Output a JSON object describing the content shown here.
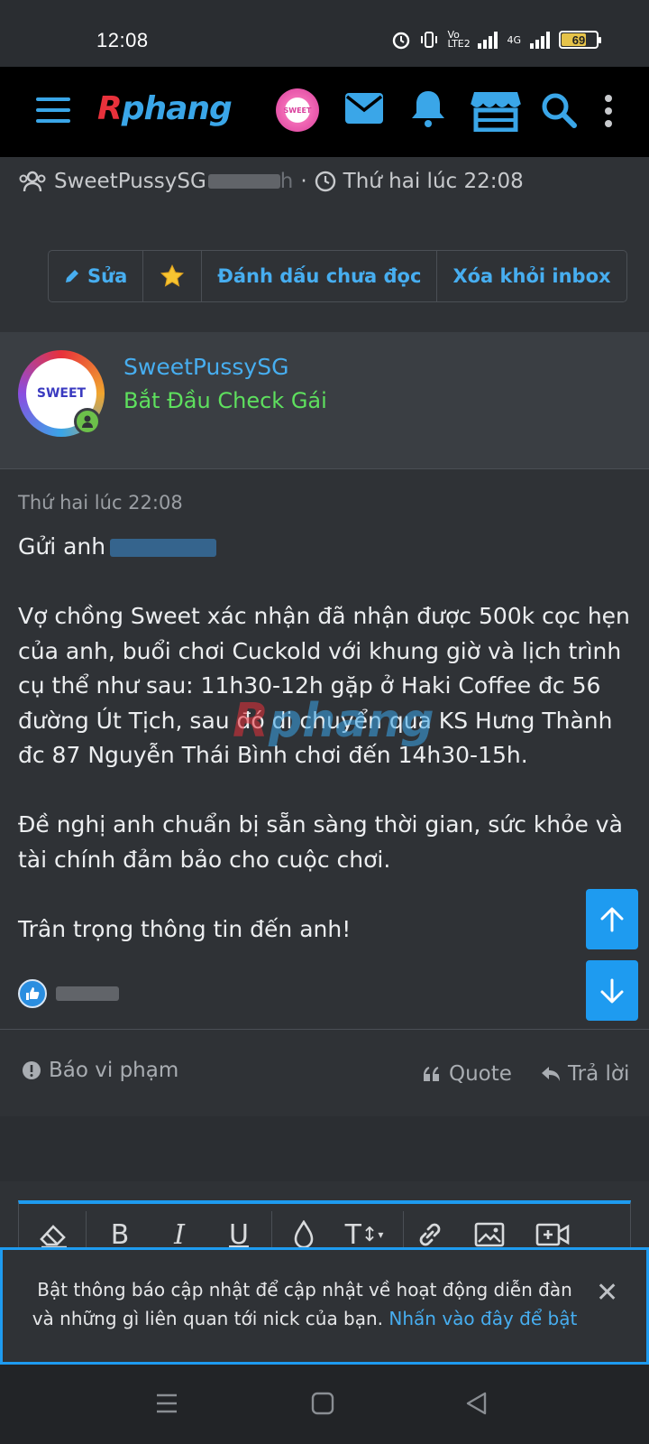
{
  "status_bar": {
    "time": "12:08",
    "volte_label": "Vo LTE2",
    "network_label": "4G",
    "battery_level": "69"
  },
  "app_header": {
    "logo_first": "R",
    "logo_rest": "phang",
    "avatar_label": "SWEET"
  },
  "thread_meta": {
    "participants": "SweetPussySG",
    "participants_tail": "h",
    "separator": "·",
    "time": "Thứ hai lúc 22:08"
  },
  "actions": {
    "edit": "Sửa",
    "mark_unread": "Đánh dấu chưa đọc",
    "remove_inbox": "Xóa khỏi inbox"
  },
  "message": {
    "author": "SweetPussySG",
    "author_title": "Bắt Đầu Check Gái",
    "avatar_text": "SWEET",
    "date": "Thứ hai lúc 22:08",
    "body": "Gửi anh\n\nVợ chồng Sweet xác nhận đã nhận được 500k cọc hẹn của anh, buổi chơi Cuckold với khung giờ và lịch trình cụ thể như sau: 11h30-12h gặp ở Haki Coffee đc 56 đường Út Tịch, sau đó di chuyển qua KS Hưng Thành đc 87 Nguyễn Thái Bình chơi đến 14h30-15h.\n\nĐề nghị anh chuẩn bị sẵn sàng thời gian, sức khỏe và tài chính đảm bảo cho cuộc chơi.\n\nTrân trọng thông tin đến anh!",
    "watermark_first": "R",
    "watermark_rest": "phang"
  },
  "footer": {
    "report": "Báo vi phạm",
    "quote": "Quote",
    "reply": "Trả lời"
  },
  "banner": {
    "text": "Bật thông báo cập nhật để cập nhật về hoạt động diễn đàn và những gì liên quan tới nick của bạn.",
    "link": "Nhấn vào đây để bật",
    "close": "✕"
  },
  "colors": {
    "accent": "#47aef0",
    "accent_strong": "#1e9bf0",
    "title_green": "#5ee05e",
    "logo_red": "#e8313b",
    "background": "#2f3236"
  },
  "icons": [
    "menu-icon",
    "mail-icon",
    "bell-icon",
    "store-icon",
    "search-icon",
    "more-icon",
    "users-icon",
    "clock-icon",
    "pencil-icon",
    "star-icon",
    "thumbs-up-icon",
    "alert-icon",
    "quote-icon",
    "reply-icon",
    "arrow-up-icon",
    "arrow-down-icon",
    "eraser-icon",
    "bold-icon",
    "italic-icon",
    "underline-icon",
    "color-drop-icon",
    "text-size-icon",
    "link-icon",
    "image-icon",
    "video-icon",
    "close-icon"
  ]
}
